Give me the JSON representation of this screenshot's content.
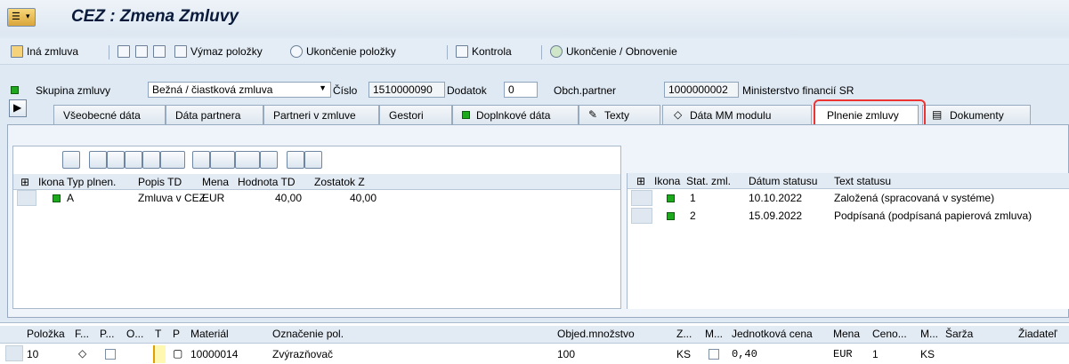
{
  "window": {
    "title": "CEZ : Zmena Zmluvy"
  },
  "toolbar": {
    "other_contract": "Iná zmluva",
    "delete_item": "Výmaz položky",
    "end_item": "Ukončenie položky",
    "check": "Kontrola",
    "end_renew": "Ukončenie / Obnovenie"
  },
  "header": {
    "group_label": "Skupina zmluvy",
    "group_value": "Bežná / čiastková zmluva",
    "number_label": "Číslo",
    "number_value": "1510000090",
    "amendment_label": "Dodatok",
    "amendment_value": "0",
    "partner_label": "Obch.partner",
    "partner_id": "1000000002",
    "partner_name": "Ministerstvo financií SR"
  },
  "tabs": [
    {
      "label": "Všeobecné dáta"
    },
    {
      "label": "Dáta partnera"
    },
    {
      "label": "Partneri v zmluve"
    },
    {
      "label": "Gestori"
    },
    {
      "label": "Doplnkové dáta"
    },
    {
      "label": "Texty"
    },
    {
      "label": "Dáta MM modulu"
    },
    {
      "label": "Plnenie zmluvy"
    },
    {
      "label": "Dokumenty"
    }
  ],
  "left_table": {
    "headers": [
      "Ikona",
      "Typ plnen.",
      "Popis TD",
      "Mena",
      "Hodnota TD",
      "Zostatok Z"
    ],
    "rows": [
      {
        "type": "A",
        "desc": "Zmluva v CEZ",
        "currency": "EUR",
        "value": "40,00",
        "remaining": "40,00"
      }
    ]
  },
  "right_table": {
    "headers": [
      "Ikona",
      "Stat. zml.",
      "Dátum statusu",
      "Text statusu"
    ],
    "rows": [
      {
        "status": "1",
        "date": "10.10.2022",
        "text": "Založená (spracovaná v systéme)"
      },
      {
        "status": "2",
        "date": "15.09.2022",
        "text": "Podpísaná (podpísaná papierová zmluva)"
      }
    ]
  },
  "bottom_table": {
    "headers": [
      "Položka",
      "F...",
      "P...",
      "O...",
      "T",
      "P",
      "Materiál",
      "Označenie pol.",
      "Objed.množstvo",
      "Z...",
      "M...",
      "Jednotková cena",
      "Mena",
      "Ceno...",
      "M...",
      "Šarža",
      "Žiadateľ"
    ],
    "row": {
      "item": "10",
      "material": "10000014",
      "desc": "Zvýrazňovač",
      "qty": "100",
      "unit": "KS",
      "price": "0,40",
      "currency": "EUR",
      "price_unit": "1",
      "uom": "KS"
    }
  }
}
